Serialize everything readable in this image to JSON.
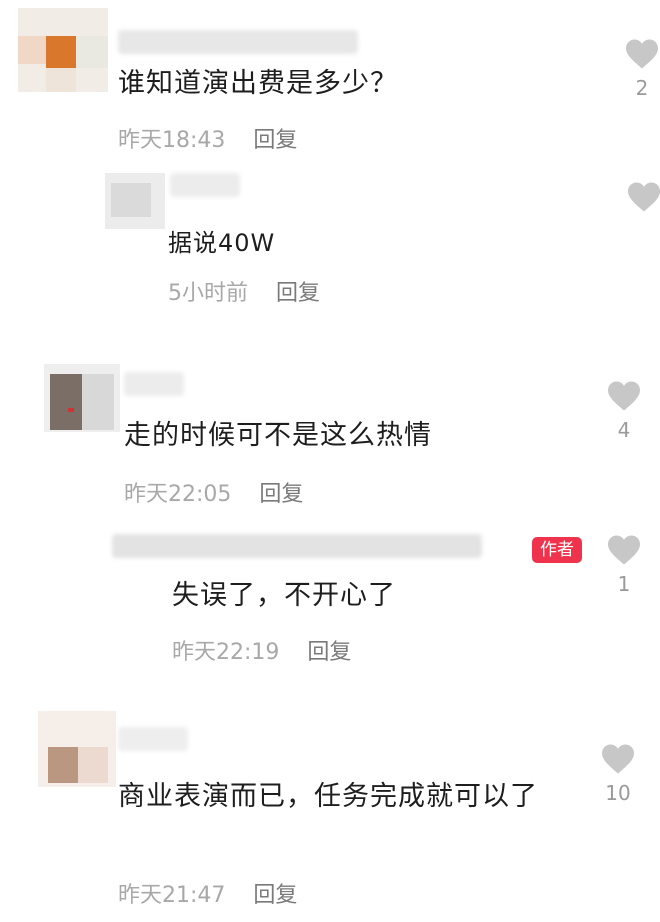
{
  "comments": [
    {
      "text": "谁知道演出费是多少？",
      "time": "昨天18:43",
      "reply_label": "回复",
      "like_count": "2",
      "reply": {
        "text": "据说40W",
        "time": "5小时前",
        "reply_label": "回复",
        "like_count": ""
      }
    },
    {
      "text": "走的时候可不是这么热情",
      "time": "昨天22:05",
      "reply_label": "回复",
      "like_count": "4",
      "reply": {
        "badge": "作者",
        "text": "失误了，不开心了",
        "time": "昨天22:19",
        "reply_label": "回复",
        "like_count": "1"
      }
    },
    {
      "text": "商业表演而已，任务完成就可以了",
      "time": "昨天21:47",
      "reply_label": "回复",
      "like_count": "10"
    }
  ],
  "icons": {
    "like": "heart-icon"
  },
  "colors": {
    "badge": "#f0334c",
    "heart": "#c7c7c7",
    "meta": "#a8a8a8"
  }
}
